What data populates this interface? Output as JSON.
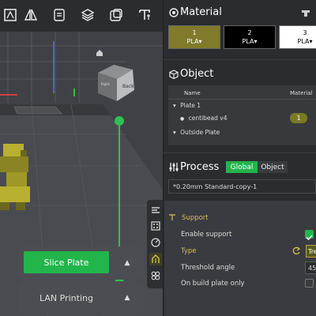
{
  "material": {
    "title": "Material",
    "filaments": [
      {
        "number": "1",
        "type": "PLA",
        "color": "#807a2a"
      },
      {
        "number": "2",
        "type": "PLA",
        "color": "#000000"
      },
      {
        "number": "3",
        "type": "PLA",
        "color": "#ffffff"
      }
    ]
  },
  "object": {
    "title": "Object",
    "columns": {
      "name": "Name",
      "material": "Material"
    },
    "plate_label": "Plate 1",
    "item_name": "centibead v4",
    "item_material": "1",
    "outside_label": "Outside Plate"
  },
  "process": {
    "title": "Process",
    "tab_global": "Global",
    "tab_object": "Object",
    "preset": "*0.20mm Standard-copy-1"
  },
  "support": {
    "section_title": "Support",
    "enable_label": "Enable support",
    "enable_checked": true,
    "type_label": "Type",
    "type_value": "Tre",
    "threshold_label": "Threshold angle",
    "threshold_value": "45",
    "build_plate_only_label": "On build plate only"
  },
  "viewport": {
    "navcube_label_back": "Back",
    "navcube_label_right": "Right"
  },
  "actions": {
    "slice_plate": "Slice Plate",
    "lan_printing": "LAN Printing"
  },
  "colors": {
    "accent_green": "#22b54b",
    "accent_yellow": "#d4c34a"
  }
}
